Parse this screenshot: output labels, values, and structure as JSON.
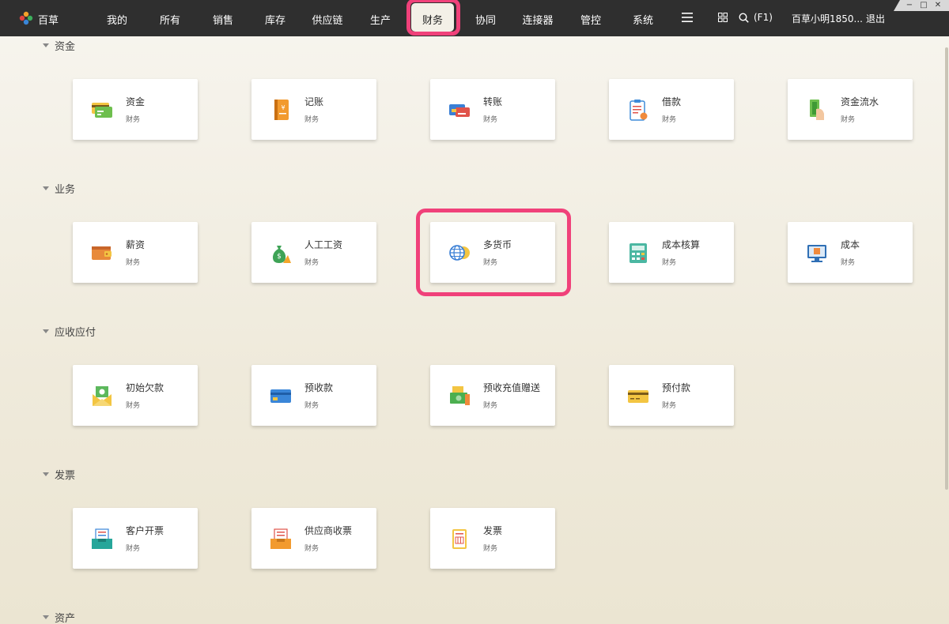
{
  "app": {
    "name": "百草"
  },
  "nav": {
    "items": [
      {
        "label": "我的"
      },
      {
        "label": "所有"
      },
      {
        "label": "销售"
      },
      {
        "label": "库存"
      },
      {
        "label": "供应链"
      },
      {
        "label": "生产"
      },
      {
        "label": "财务"
      },
      {
        "label": "协同"
      },
      {
        "label": "连接器"
      },
      {
        "label": "管控"
      },
      {
        "label": "系统"
      }
    ],
    "active": "财务",
    "search_hint": "(F1)",
    "user": "百草小明1850...",
    "logout": "退出"
  },
  "window_controls": {
    "minimize": "−",
    "maximize": "□",
    "close": "✕"
  },
  "sections": [
    {
      "title": "资金",
      "cards": [
        {
          "title": "资金",
          "sub": "财务",
          "icon": "money-card-icon"
        },
        {
          "title": "记账",
          "sub": "财务",
          "icon": "ledger-book-icon"
        },
        {
          "title": "转账",
          "sub": "财务",
          "icon": "transfer-cards-icon"
        },
        {
          "title": "借款",
          "sub": "财务",
          "icon": "loan-clipboard-icon"
        },
        {
          "title": "资金流水",
          "sub": "财务",
          "icon": "cash-flow-icon"
        }
      ]
    },
    {
      "title": "业务",
      "cards": [
        {
          "title": "薪资",
          "sub": "财务",
          "icon": "wallet-icon"
        },
        {
          "title": "人工工资",
          "sub": "财务",
          "icon": "money-bag-icon"
        },
        {
          "title": "多货币",
          "sub": "财务",
          "icon": "globe-currency-icon"
        },
        {
          "title": "成本核算",
          "sub": "财务",
          "icon": "calculator-icon"
        },
        {
          "title": "成本",
          "sub": "财务",
          "icon": "monitor-box-icon"
        }
      ]
    },
    {
      "title": "应收应付",
      "cards": [
        {
          "title": "初始欠款",
          "sub": "财务",
          "icon": "envelope-money-icon"
        },
        {
          "title": "预收款",
          "sub": "财务",
          "icon": "bank-card-icon"
        },
        {
          "title": "预收充值赠送",
          "sub": "财务",
          "icon": "cash-stack-icon"
        },
        {
          "title": "预付款",
          "sub": "财务",
          "icon": "yellow-card-icon"
        }
      ]
    },
    {
      "title": "发票",
      "cards": [
        {
          "title": "客户开票",
          "sub": "财务",
          "icon": "tray-invoice-icon"
        },
        {
          "title": "供应商收票",
          "sub": "财务",
          "icon": "inbox-invoice-icon"
        },
        {
          "title": "发票",
          "sub": "财务",
          "icon": "receipt-icon"
        }
      ]
    },
    {
      "title": "资产",
      "cards": []
    }
  ],
  "colors": {
    "topbar": "#2f2f2f",
    "highlight": "#f0417a",
    "background": "#f3efe3"
  }
}
